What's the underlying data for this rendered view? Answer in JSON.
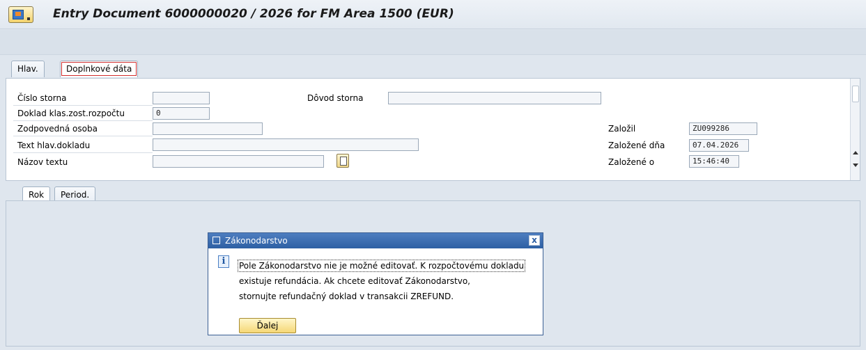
{
  "window": {
    "title": "Entry Document 6000000020 / 2026 for FM Area 1500 (EUR)"
  },
  "header_tabs": [
    {
      "label": "Hlav."
    },
    {
      "label": "Doplnkové dáta"
    }
  ],
  "form": {
    "storno_number": {
      "label": "Číslo storna",
      "value": ""
    },
    "storno_reason": {
      "label": "Dôvod storna",
      "value": ""
    },
    "budget_doc": {
      "label": "Doklad klas.zost.rozpočtu",
      "value": "0"
    },
    "responsible": {
      "label": "Zodpovedná osoba",
      "value": ""
    },
    "header_text": {
      "label": "Text hlav.dokladu",
      "value": ""
    },
    "text_name": {
      "label": "Názov textu",
      "value": ""
    },
    "created_by": {
      "label": "Založil",
      "value": "ZU099286"
    },
    "created_on": {
      "label": "Založené dňa",
      "value": "07.04.2026"
    },
    "created_at": {
      "label": "Založené o",
      "value": "15:46:40"
    }
  },
  "item_tabs": [
    {
      "label": "Rok"
    },
    {
      "label": "Period."
    }
  ],
  "dialog": {
    "title": "Zákonodarstvo",
    "close": "x",
    "lines": [
      "Pole Zákonodarstvo nie je možné editovať. K rozpočtovému dokladu",
      "existuje refundácia. Ak chcete editovať Zákonodarstvo,",
      "stornujte refundačný doklad v transakcii ZREFUND."
    ],
    "button": "Ďalej"
  },
  "icons": {
    "menu": "sap-menu-icon",
    "text_edit": "text-edit-icon",
    "info": "info-icon",
    "close": "close-icon"
  },
  "colors": {
    "dialog_title": "#2d5fa3",
    "button_bg": "#f5d776",
    "panel_bg": "#ffffff",
    "app_bg": "#dfe6ee"
  }
}
